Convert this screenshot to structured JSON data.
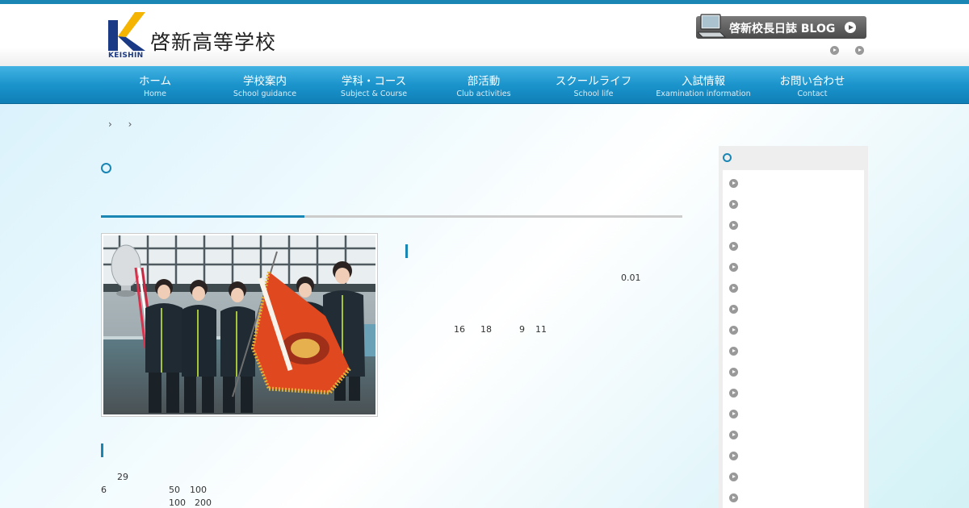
{
  "header": {
    "school_name": "啓新高等学校",
    "logo_text": "KEISHIN",
    "blog_button_label": "啓新校長日誌 BLOG"
  },
  "nav": {
    "items": [
      {
        "label": "ホーム",
        "sub": "Home"
      },
      {
        "label": "学校案内",
        "sub": "School guidance"
      },
      {
        "label": "学科・コース",
        "sub": "Subject & Course"
      },
      {
        "label": "部活動",
        "sub": "Club activities"
      },
      {
        "label": "スクールライフ",
        "sub": "School life"
      },
      {
        "label": "入試情報",
        "sub": "Examination information"
      },
      {
        "label": "お問い合わせ",
        "sub": "Contact"
      }
    ]
  },
  "breadcrumb": {
    "separator_1": "›",
    "separator_2": "›"
  },
  "article": {
    "upper_numbers": [
      "0.01",
      "16",
      "18",
      "9",
      "11"
    ],
    "lower_numbers": [
      "29",
      "6",
      "50",
      "100",
      "100",
      "200"
    ]
  },
  "colors": {
    "accent": "#1a86b4",
    "nav_top": "#43b3e3",
    "nav_bottom": "#0f7fb6",
    "sidebar_bg": "#eeeeee"
  },
  "sidebar": {
    "item_count": 16
  }
}
